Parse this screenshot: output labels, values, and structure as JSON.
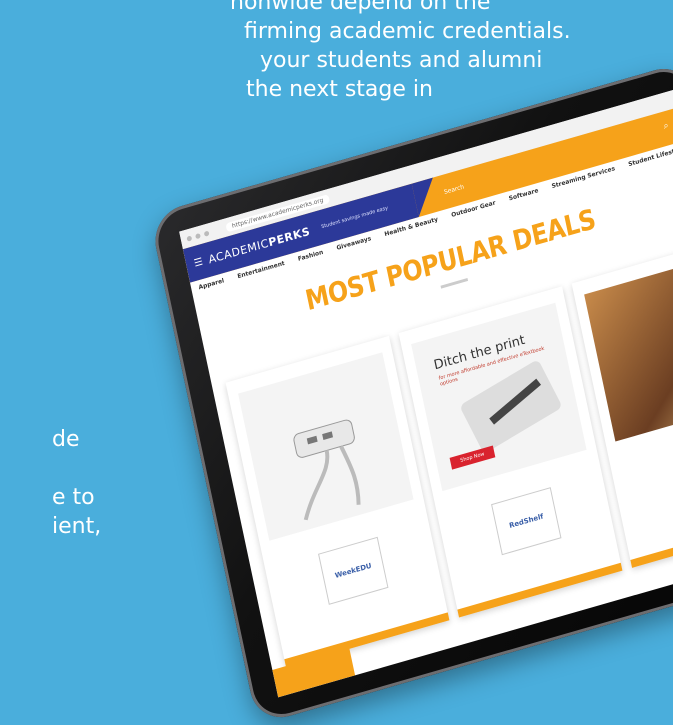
{
  "background_text": {
    "top_lines": [
      "nonwide depend on the",
      "firming academic credentials.",
      "your students and alumni",
      "the next stage in"
    ],
    "left_lines": [
      "de",
      "",
      "e to",
      "ient,"
    ]
  },
  "browser": {
    "url": "https://www.academicperks.org"
  },
  "site": {
    "logo_light": "ACADEMIC",
    "logo_bold": "PERKS",
    "tagline": "Student savings made easy",
    "search_placeholder": "Search",
    "nav": [
      "Apparel",
      "Entertainment",
      "Fashion",
      "Giveaways",
      "Health & Beauty",
      "Outdoor Gear",
      "Software",
      "Streaming Services",
      "Student Lifestyle"
    ],
    "section_title": "MOST POPULAR DEALS"
  },
  "cards": [
    {
      "brand": "WeekEDU"
    },
    {
      "headline": "Ditch the print",
      "subline": "for more affordable and effective eTextbook options",
      "brand_label": "RedShelf",
      "button": "Shop Now"
    },
    {}
  ],
  "colors": {
    "background": "#4aaedc",
    "accent_orange": "#f6a21a",
    "header_blue": "#2c3999",
    "button_red": "#d9232e"
  }
}
